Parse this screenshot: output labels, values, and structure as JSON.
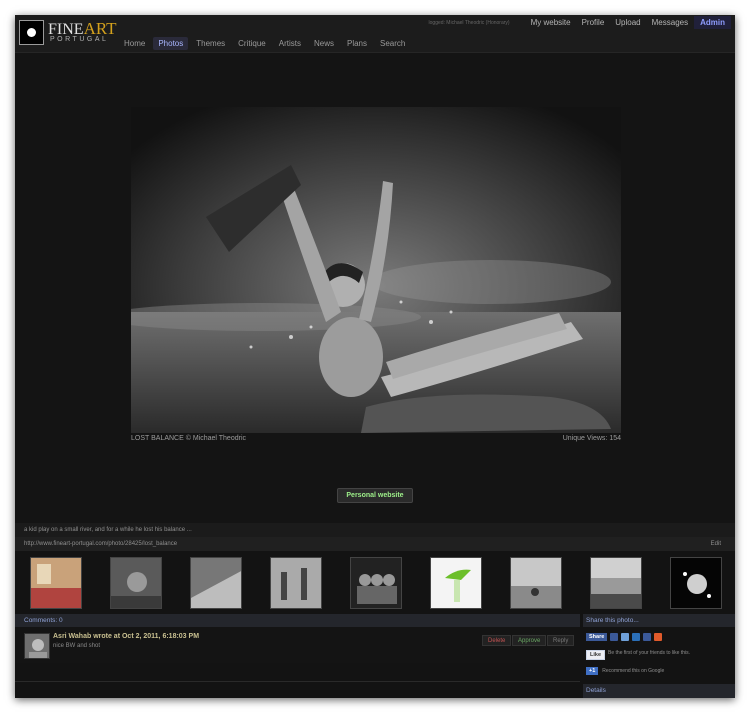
{
  "header": {
    "logo": {
      "fine": "FINE",
      "art": "ART",
      "portugal": "PORTUGAL"
    },
    "nav": [
      {
        "label": "Home"
      },
      {
        "label": "Photos",
        "active": true
      },
      {
        "label": "Themes"
      },
      {
        "label": "Critique"
      },
      {
        "label": "Artists"
      },
      {
        "label": "News"
      },
      {
        "label": "Plans"
      },
      {
        "label": "Search"
      }
    ],
    "logged_text": "logged: Michael Theodric (Honorary)",
    "user_links": [
      "My website",
      "Profile",
      "Upload",
      "Messages"
    ],
    "admin_label": "Admin"
  },
  "photo": {
    "caption": "LOST BALANCE © Michael Theodric",
    "views": "Unique Views: 154",
    "website_button": "Personal website"
  },
  "description": "a kid play on a small river, and for a while he lost his balance ...",
  "url": "http://www.fineart-portugal.com/photo/28425/lost_balance",
  "edit_label": "Edit",
  "thumbnails": [
    {
      "name": "thumb-1"
    },
    {
      "name": "thumb-2"
    },
    {
      "name": "thumb-3"
    },
    {
      "name": "thumb-4"
    },
    {
      "name": "thumb-5"
    },
    {
      "name": "thumb-6"
    },
    {
      "name": "thumb-7"
    },
    {
      "name": "thumb-8"
    },
    {
      "name": "thumb-9"
    }
  ],
  "comments": {
    "header": "Comments: 0",
    "items": [
      {
        "author": "Asri Wahab wrote at Oct 2, 2011, 6:18:03 PM",
        "text": "nice BW and shot",
        "actions": {
          "delete": "Delete",
          "approve": "Approve",
          "reply": "Reply"
        }
      }
    ]
  },
  "share": {
    "header": "Share this photo...",
    "fb_share": "Share",
    "like": "Like",
    "like_text": "Be the first of your friends to like this.",
    "plus": "+1",
    "plus_text": "Recommend this on Google"
  },
  "details_label": "Details",
  "colors": {
    "accent": "#8f9dff",
    "website_button_text": "#9ef08a",
    "delete": "#c15252",
    "approve": "#6aa864"
  }
}
